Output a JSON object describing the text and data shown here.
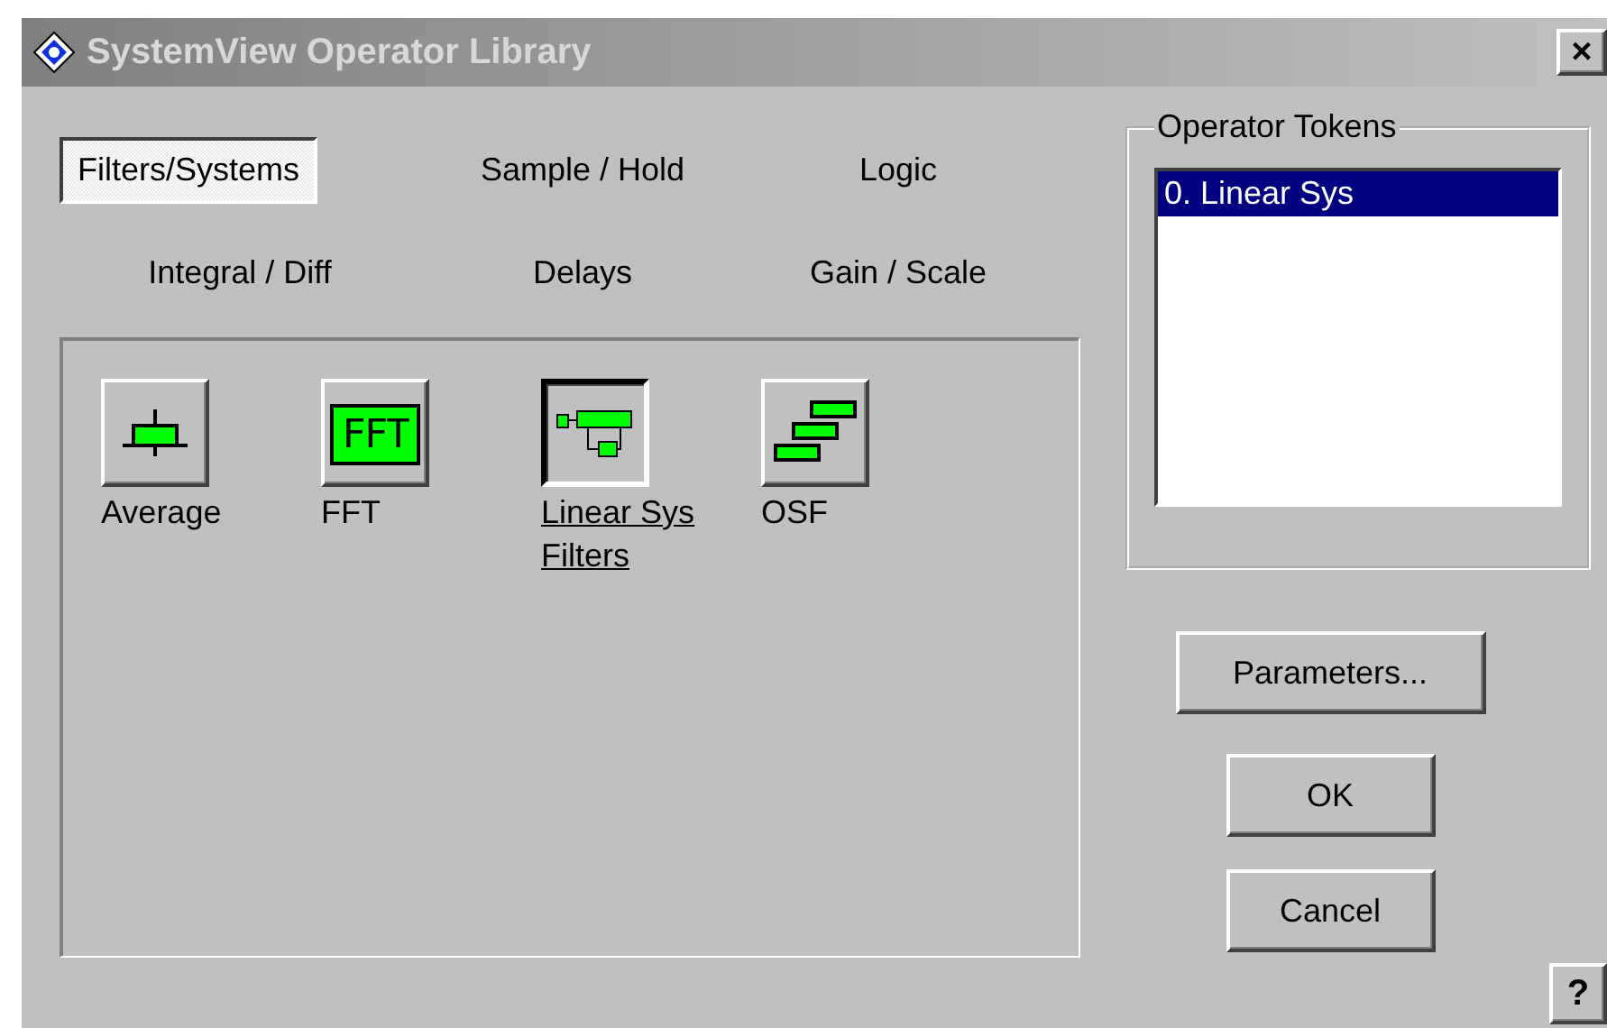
{
  "window": {
    "title": "SystemView Operator Library",
    "close": "×"
  },
  "tabs": [
    {
      "label": "Filters/Systems",
      "selected": true
    },
    {
      "label": "Sample / Hold",
      "selected": false
    },
    {
      "label": "Logic",
      "selected": false
    },
    {
      "label": "Integral / Diff",
      "selected": false
    },
    {
      "label": "Delays",
      "selected": false
    },
    {
      "label": "Gain / Scale",
      "selected": false
    }
  ],
  "operators": [
    {
      "kind": "average",
      "label": "Average",
      "selected": false
    },
    {
      "kind": "fft",
      "label": "FFT",
      "icon_text": "FFT",
      "selected": false
    },
    {
      "kind": "linear",
      "label": "Linear Sys Filters",
      "selected": true
    },
    {
      "kind": "osf",
      "label": "OSF",
      "selected": false
    }
  ],
  "operator_tokens": {
    "title": "Operator Tokens",
    "items": [
      {
        "label": "0. Linear Sys",
        "selected": true
      }
    ]
  },
  "buttons": [
    {
      "kind": "parameters",
      "label": "Parameters..."
    },
    {
      "kind": "ok",
      "label": "OK"
    },
    {
      "kind": "cancel",
      "label": "Cancel"
    }
  ],
  "help_button": "?"
}
